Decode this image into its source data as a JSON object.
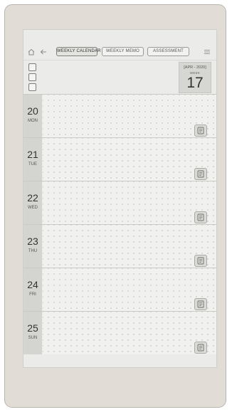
{
  "toolbar": {
    "tabs": [
      {
        "label": "WEEKLY CALENDAR",
        "active": true
      },
      {
        "label": "WEEKLY MEMO",
        "active": false
      },
      {
        "label": "ASSESSMENT",
        "active": false
      }
    ]
  },
  "header": {
    "year_month": "[APR - 2020]",
    "week_label": "WEEK",
    "week_number": "17",
    "checkbox_count": 3
  },
  "days": [
    {
      "number": "20",
      "weekday": "MON"
    },
    {
      "number": "21",
      "weekday": "TUE"
    },
    {
      "number": "22",
      "weekday": "WED"
    },
    {
      "number": "23",
      "weekday": "THU"
    },
    {
      "number": "24",
      "weekday": "FRI"
    },
    {
      "number": "25",
      "weekday": "SUN"
    }
  ],
  "icons": {
    "home": "home-icon",
    "back": "back-arrow-icon",
    "menu": "menu-icon",
    "memo": "memo-note-icon"
  },
  "colors": {
    "device_frame": "#e1ddd6",
    "screen": "#ebebea",
    "day_label_bg": "#d4d4d1"
  }
}
